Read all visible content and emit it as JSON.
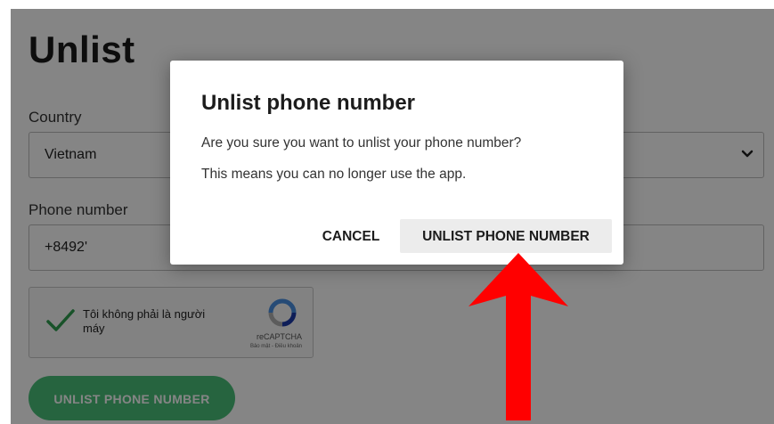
{
  "page": {
    "title": "Unlist",
    "country_label": "Country",
    "country_value": "Vietnam",
    "phone_label": "Phone number",
    "phone_value": "+8492'",
    "submit_label": "UNLIST PHONE NUMBER"
  },
  "captcha": {
    "text": "Tôi không phải là người máy",
    "brand": "reCAPTCHA",
    "links": "Bảo mật - Điều khoản"
  },
  "dialog": {
    "title": "Unlist phone number",
    "body_line1": "Are you sure you want to unlist your phone number?",
    "body_line2": "This means you can no longer use the app.",
    "cancel_label": "CANCEL",
    "confirm_label": "UNLIST PHONE NUMBER"
  },
  "colors": {
    "overlay": "rgba(0,0,0,0.48)",
    "submit_button": "#49c07a",
    "checkmark": "#2e9e4f",
    "arrow": "#ff0000",
    "confirm_bg": "#ececec"
  },
  "icons": {
    "dropdown": "chevron-down-icon",
    "captcha_check": "checkmark-icon",
    "captcha_logo": "recaptcha-icon",
    "annotation": "red-arrow-icon"
  }
}
